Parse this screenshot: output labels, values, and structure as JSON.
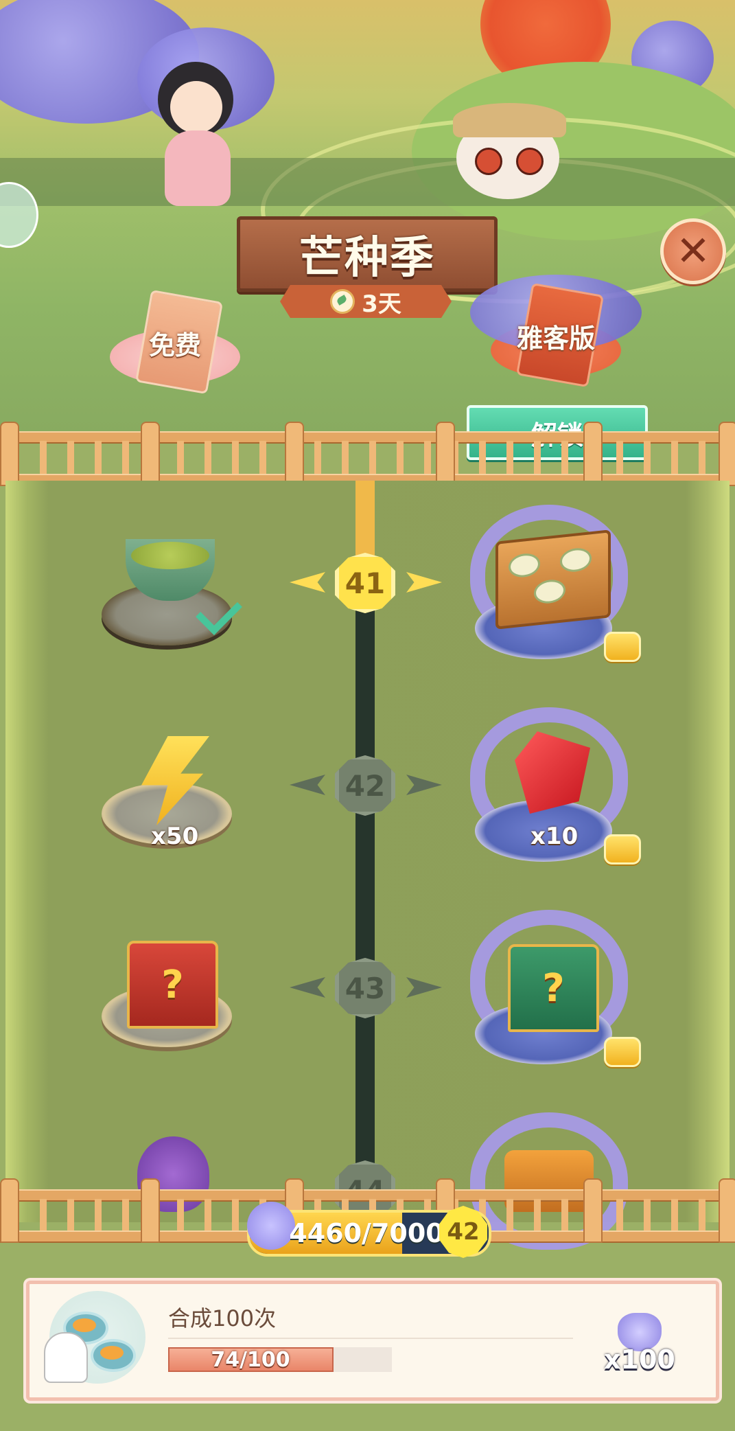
{
  "header": {
    "title": "芒种季",
    "days_remaining": "3天",
    "free_tier_label": "免费",
    "premium_tier_label": "雅客版",
    "unlock_label": "解锁"
  },
  "levels": [
    {
      "level": "41",
      "current": true,
      "free_reward": "lotus-seed-soup",
      "free_qty": "",
      "free_claimed": true,
      "premium_reward": "pastry-box",
      "premium_qty": ""
    },
    {
      "level": "42",
      "current": false,
      "free_reward": "energy-bolt",
      "free_qty": "x50",
      "free_claimed": false,
      "premium_reward": "red-gem",
      "premium_qty": "x10"
    },
    {
      "level": "43",
      "current": false,
      "free_reward": "mystery-chest-red",
      "free_qty": "",
      "free_claimed": false,
      "premium_reward": "mystery-chest-green",
      "premium_qty": ""
    },
    {
      "level": "44",
      "current": false,
      "free_reward": "purple-pouch",
      "free_qty": "",
      "free_claimed": false,
      "premium_reward": "gift-bundle",
      "premium_qty": ""
    }
  ],
  "pass_progress": {
    "text": "4460/7000",
    "value": 4460,
    "max": 7000,
    "level": "42"
  },
  "task": {
    "title": "合成100次",
    "progress_text": "74/100",
    "progress_value": 74,
    "progress_max": 100,
    "reward_qty": "x100"
  },
  "colors": {
    "title_plaque": "#a05a3a",
    "unlock_button": "#4fcaa0",
    "track_done": "#f0b94a",
    "progress_fill": "#f4bd2d",
    "task_fill": "#ee9479"
  }
}
